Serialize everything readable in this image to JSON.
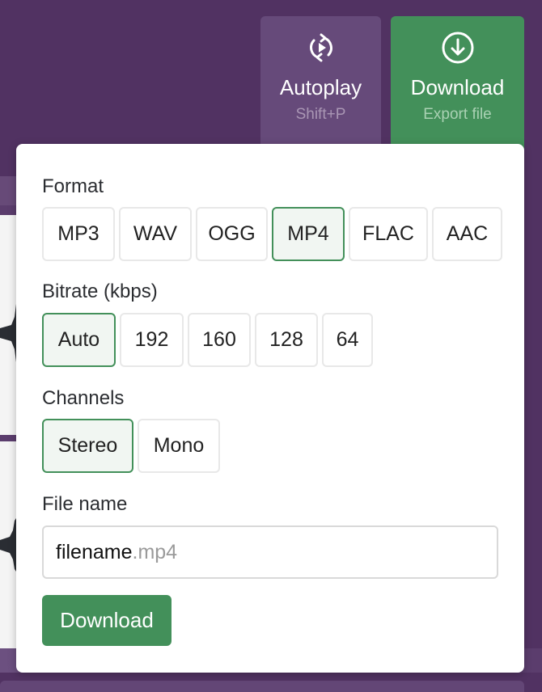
{
  "toolbar": {
    "autoplay": {
      "label": "Autoplay",
      "shortcut": "Shift+P",
      "icon": "autoplay-loop-icon"
    },
    "download": {
      "label": "Download",
      "sublabel": "Export file",
      "icon": "download-circle-icon"
    }
  },
  "download_popover": {
    "format": {
      "label": "Format",
      "options": [
        "MP3",
        "WAV",
        "OGG",
        "MP4",
        "FLAC",
        "AAC"
      ],
      "selected": "MP4"
    },
    "bitrate": {
      "label": "Bitrate (kbps)",
      "options": [
        "Auto",
        "192",
        "160",
        "128",
        "64"
      ],
      "selected": "Auto"
    },
    "channels": {
      "label": "Channels",
      "options": [
        "Stereo",
        "Mono"
      ],
      "selected": "Stereo"
    },
    "file_name": {
      "label": "File name",
      "value": "filename",
      "extension": ".mp4"
    },
    "submit_label": "Download"
  },
  "colors": {
    "background": "#513262",
    "accent_green": "#43905a",
    "autoplay_button": "#664a7a",
    "selected_option_bg": "#f1f6f2"
  }
}
